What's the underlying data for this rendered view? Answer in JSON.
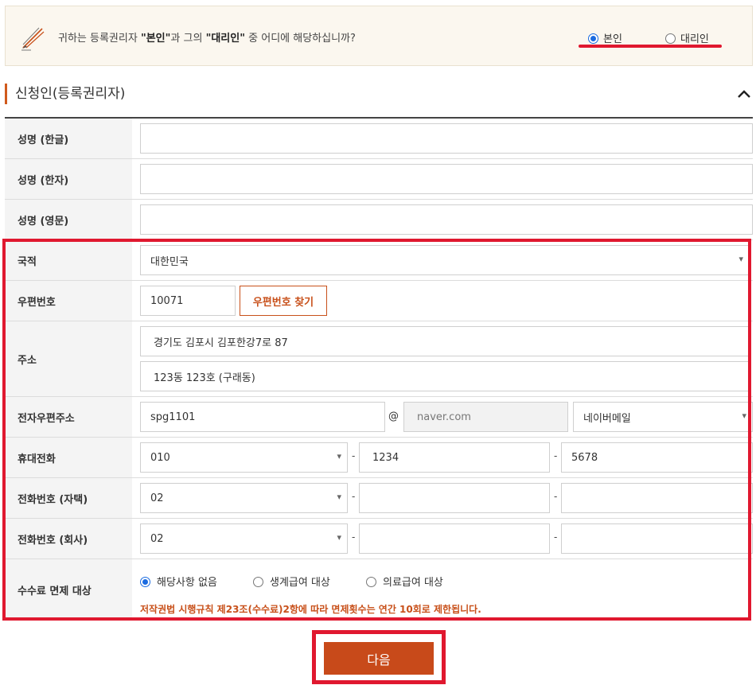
{
  "question": {
    "text_prefix": "귀하는 등록권리자 ",
    "bold1": "\"본인\"",
    "text_mid": "과 그의 ",
    "bold2": "\"대리인\"",
    "text_suffix": " 중 어디에 해당하십니까?",
    "options": [
      {
        "label": "본인",
        "selected": true
      },
      {
        "label": "대리인",
        "selected": false
      }
    ],
    "icon": "pen-icon"
  },
  "section": {
    "title": "신청인(등록권리자)",
    "collapse_icon": "chevron-up-icon"
  },
  "form": {
    "name_korean": {
      "label": "성명 (한글)",
      "value": ""
    },
    "name_hanja": {
      "label": "성명 (한자)",
      "value": ""
    },
    "name_english": {
      "label": "성명 (영문)",
      "value": ""
    },
    "nationality": {
      "label": "국적",
      "value": "대한민국"
    },
    "postal": {
      "label": "우편번호",
      "value": "10071",
      "button": "우편번호 찾기"
    },
    "address": {
      "label": "주소",
      "line1": "경기도 김포시 김포한강7로 87",
      "line2": "123동 123호 (구래동)"
    },
    "email": {
      "label": "전자우편주소",
      "local": "spg1101",
      "at": "@",
      "domain": "naver.com",
      "provider": "네이버메일"
    },
    "mobile": {
      "label": "휴대전화",
      "part1": "010",
      "part2": "1234",
      "part3": "5678",
      "dash": "-"
    },
    "home_phone": {
      "label": "전화번호 (자택)",
      "part1": "02",
      "part2": "",
      "part3": "",
      "dash": "-"
    },
    "work_phone": {
      "label": "전화번호 (회사)",
      "part1": "02",
      "part2": "",
      "part3": "",
      "dash": "-"
    },
    "fee_exemption": {
      "label": "수수료 면제 대상",
      "options": [
        {
          "label": "해당사항 없음",
          "selected": true
        },
        {
          "label": "생계급여 대상",
          "selected": false
        },
        {
          "label": "의료급여 대상",
          "selected": false
        }
      ],
      "note": "저작권법 시행규칙 제23조(수수료)2항에 따라 면제횟수는 연간 10회로 제한됩니다."
    }
  },
  "next_button": "다음",
  "colors": {
    "accent": "#c84a1a",
    "highlight": "#e0182f",
    "radio": "#1a6be0"
  }
}
